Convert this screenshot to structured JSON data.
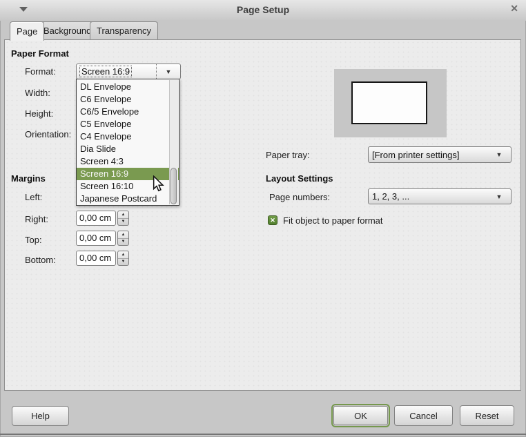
{
  "window": {
    "title": "Page Setup"
  },
  "icons": {
    "close": "✕",
    "combo_arrow": "▼",
    "spin_up": "▲",
    "spin_down": "▼",
    "checkbox_check": "✕"
  },
  "tabs": [
    {
      "label": "Page"
    },
    {
      "label": "Background"
    },
    {
      "label": "Transparency"
    }
  ],
  "paper_format": {
    "section_title": "Paper Format",
    "format_label": "Format:",
    "format_value": "Screen 16:9",
    "width_label": "Width:",
    "height_label": "Height:",
    "orientation_label": "Orientation:",
    "dropdown_options": [
      "DL Envelope",
      "C6 Envelope",
      "C6/5 Envelope",
      "C5 Envelope",
      "C4 Envelope",
      "Dia Slide",
      "Screen 4:3",
      "Screen 16:9",
      "Screen 16:10",
      "Japanese Postcard"
    ],
    "selected_option": "Screen 16:9"
  },
  "margins": {
    "section_title": "Margins",
    "left_label": "Left:",
    "right_label": "Right:",
    "top_label": "Top:",
    "bottom_label": "Bottom:",
    "right_value": "0,00 cm",
    "top_value": "0,00 cm",
    "bottom_value": "0,00 cm"
  },
  "right_panel": {
    "paper_tray_label": "Paper tray:",
    "paper_tray_value": "[From printer settings]",
    "layout_settings_title": "Layout Settings",
    "page_numbers_label": "Page numbers:",
    "page_numbers_value": "1, 2, 3, ...",
    "fit_object_label": "Fit object to paper format",
    "fit_object_checked": true
  },
  "buttons": {
    "help": "Help",
    "ok": "OK",
    "cancel": "Cancel",
    "reset": "Reset"
  },
  "colors": {
    "accent_green": "#7a9a50",
    "checkbox_green": "#5f8a3c",
    "dialog_bg": "#c7c7c7",
    "panel_bg": "#ececec"
  }
}
